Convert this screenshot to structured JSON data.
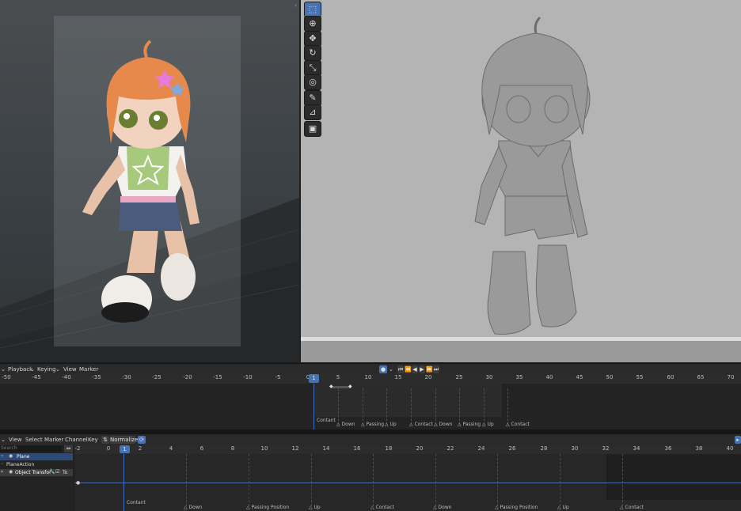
{
  "toolbar_icons": [
    "select-box-icon",
    "cursor-icon",
    "move-icon",
    "rotate-icon",
    "scale-icon",
    "transform-icon",
    "annotate-icon",
    "measure-icon",
    "add-cube-icon"
  ],
  "timeline": {
    "menus": [
      "Playback",
      "Keying",
      "View",
      "Marker"
    ],
    "current_frame": "1",
    "ticks": [
      "-50",
      "-45",
      "-40",
      "-35",
      "-30",
      "-25",
      "-20",
      "-15",
      "-10",
      "-5",
      "0",
      "5",
      "10",
      "15",
      "20",
      "25",
      "30",
      "35",
      "40",
      "45",
      "50",
      "55",
      "60",
      "65",
      "70"
    ],
    "markers": [
      "Contant",
      "Down",
      "Passing",
      "Up",
      "Contact",
      "Down",
      "Passing",
      "Up",
      "Contact"
    ]
  },
  "graph": {
    "menus": [
      "View",
      "Select",
      "Marker",
      "Channel",
      "Key"
    ],
    "normalize_label": "Normalize",
    "search_placeholder": "Search",
    "channels": [
      "Plane",
      "PlaneAction",
      "Object Transfor"
    ],
    "channel_suffix": "To",
    "current_frame": "1",
    "ticks": [
      "-2",
      "0",
      "2",
      "4",
      "6",
      "8",
      "10",
      "12",
      "14",
      "16",
      "18",
      "20",
      "22",
      "24",
      "26",
      "28",
      "30",
      "32",
      "34",
      "36",
      "38",
      "40"
    ],
    "markers": [
      "Contant",
      "Down",
      "Passing Position",
      "Up",
      "Contact",
      "Down",
      "Passing Position",
      "Up",
      "Contact"
    ]
  },
  "colors": {
    "accent": "#4772b3",
    "playhead": "#3f6fbf"
  }
}
